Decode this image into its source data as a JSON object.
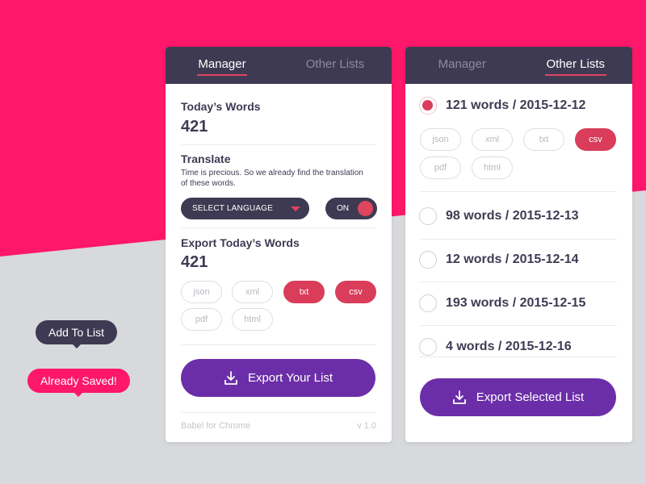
{
  "tooltips": {
    "add_to_list": "Add To List",
    "already_saved": "Already Saved!"
  },
  "left_panel": {
    "tabs": [
      {
        "label": "Manager",
        "active": true
      },
      {
        "label": "Other Lists",
        "active": false
      }
    ],
    "todays_words_label": "Today’s Words",
    "todays_words_count": "421",
    "translate_label": "Translate",
    "translate_desc_line1": "Time is precious. So we already find the translation",
    "translate_desc_line2": "of these words.",
    "language_select": "SELECT LANGUAGE",
    "toggle_label": "ON",
    "export_label": "Export Today’s Words",
    "export_count": "421",
    "formats": [
      {
        "label": "json",
        "selected": false
      },
      {
        "label": "xml",
        "selected": false
      },
      {
        "label": "txt",
        "selected": true
      },
      {
        "label": "csv",
        "selected": true
      },
      {
        "label": "pdf",
        "selected": false
      },
      {
        "label": "html",
        "selected": false
      }
    ],
    "export_button": "Export Your List",
    "footer_app": "Babel for Chrome",
    "footer_version": "v 1.0"
  },
  "right_panel": {
    "tabs": [
      {
        "label": "Manager",
        "active": false
      },
      {
        "label": "Other Lists",
        "active": true
      }
    ],
    "lists": [
      {
        "label": "121 words / 2015-12-12",
        "checked": true
      },
      {
        "label": "98 words / 2015-12-13",
        "checked": false
      },
      {
        "label": "12 words / 2015-12-14",
        "checked": false
      },
      {
        "label": "193 words / 2015-12-15",
        "checked": false
      },
      {
        "label": "4 words / 2015-12-16",
        "checked": false
      }
    ],
    "formats": [
      {
        "label": "json",
        "selected": false
      },
      {
        "label": "xml",
        "selected": false
      },
      {
        "label": "txt",
        "selected": false
      },
      {
        "label": "csv",
        "selected": true
      },
      {
        "label": "pdf",
        "selected": false
      },
      {
        "label": "html",
        "selected": false
      }
    ],
    "export_button": "Export Selected List"
  },
  "colors": {
    "accent_pink": "#ff1769",
    "dark": "#3f3a53",
    "chip_selected": "#d93d5a",
    "button_purple": "#6c2ea8"
  }
}
